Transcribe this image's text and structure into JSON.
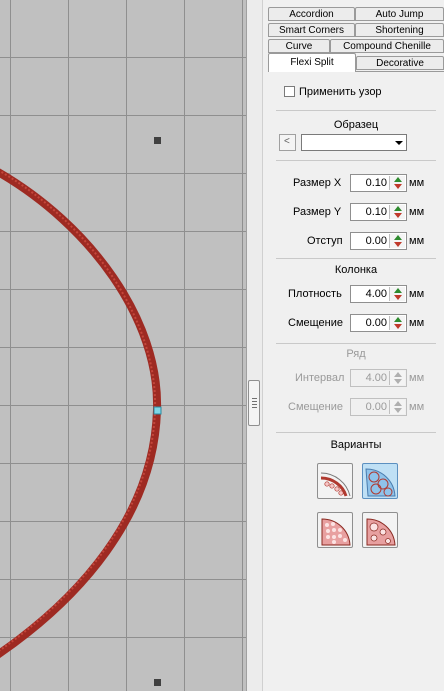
{
  "tabs": {
    "row1": [
      "Accordion",
      "Auto Jump"
    ],
    "row2": [
      "Smart Corners",
      "Shortening"
    ],
    "row3": [
      "Curve",
      "Compound Chenille"
    ],
    "row4": [
      "Flexi Split",
      "Decorative"
    ],
    "active": "Flexi Split"
  },
  "apply_pattern": {
    "label": "Применить узор",
    "checked": false
  },
  "sample": {
    "title": "Образец",
    "prev_label": "<",
    "selected": ""
  },
  "size_x": {
    "label": "Размер X",
    "value": "0.10",
    "unit": "мм"
  },
  "size_y": {
    "label": "Размер Y",
    "value": "0.10",
    "unit": "мм"
  },
  "offset": {
    "label": "Отступ",
    "value": "0.00",
    "unit": "мм"
  },
  "column": {
    "title": "Колонка",
    "density": {
      "label": "Плотность",
      "value": "4.00",
      "unit": "мм"
    },
    "shift": {
      "label": "Смещение",
      "value": "0.00",
      "unit": "мм"
    }
  },
  "row": {
    "title": "Ряд",
    "interval": {
      "label": "Интервал",
      "value": "4.00",
      "unit": "мм"
    },
    "shift": {
      "label": "Смещение",
      "value": "0.00",
      "unit": "мм"
    }
  },
  "variants": {
    "title": "Варианты",
    "selected_index": 1
  },
  "colors": {
    "thread": "#9e2a22",
    "thread_highlight": "#c4473c",
    "grid": "#8f8f8f",
    "canvas": "#c0c0c0",
    "selected_blue": "#bfe0f5"
  },
  "icons": {
    "spin_up": "green-up-arrow-icon",
    "spin_down": "red-down-arrow-icon"
  }
}
